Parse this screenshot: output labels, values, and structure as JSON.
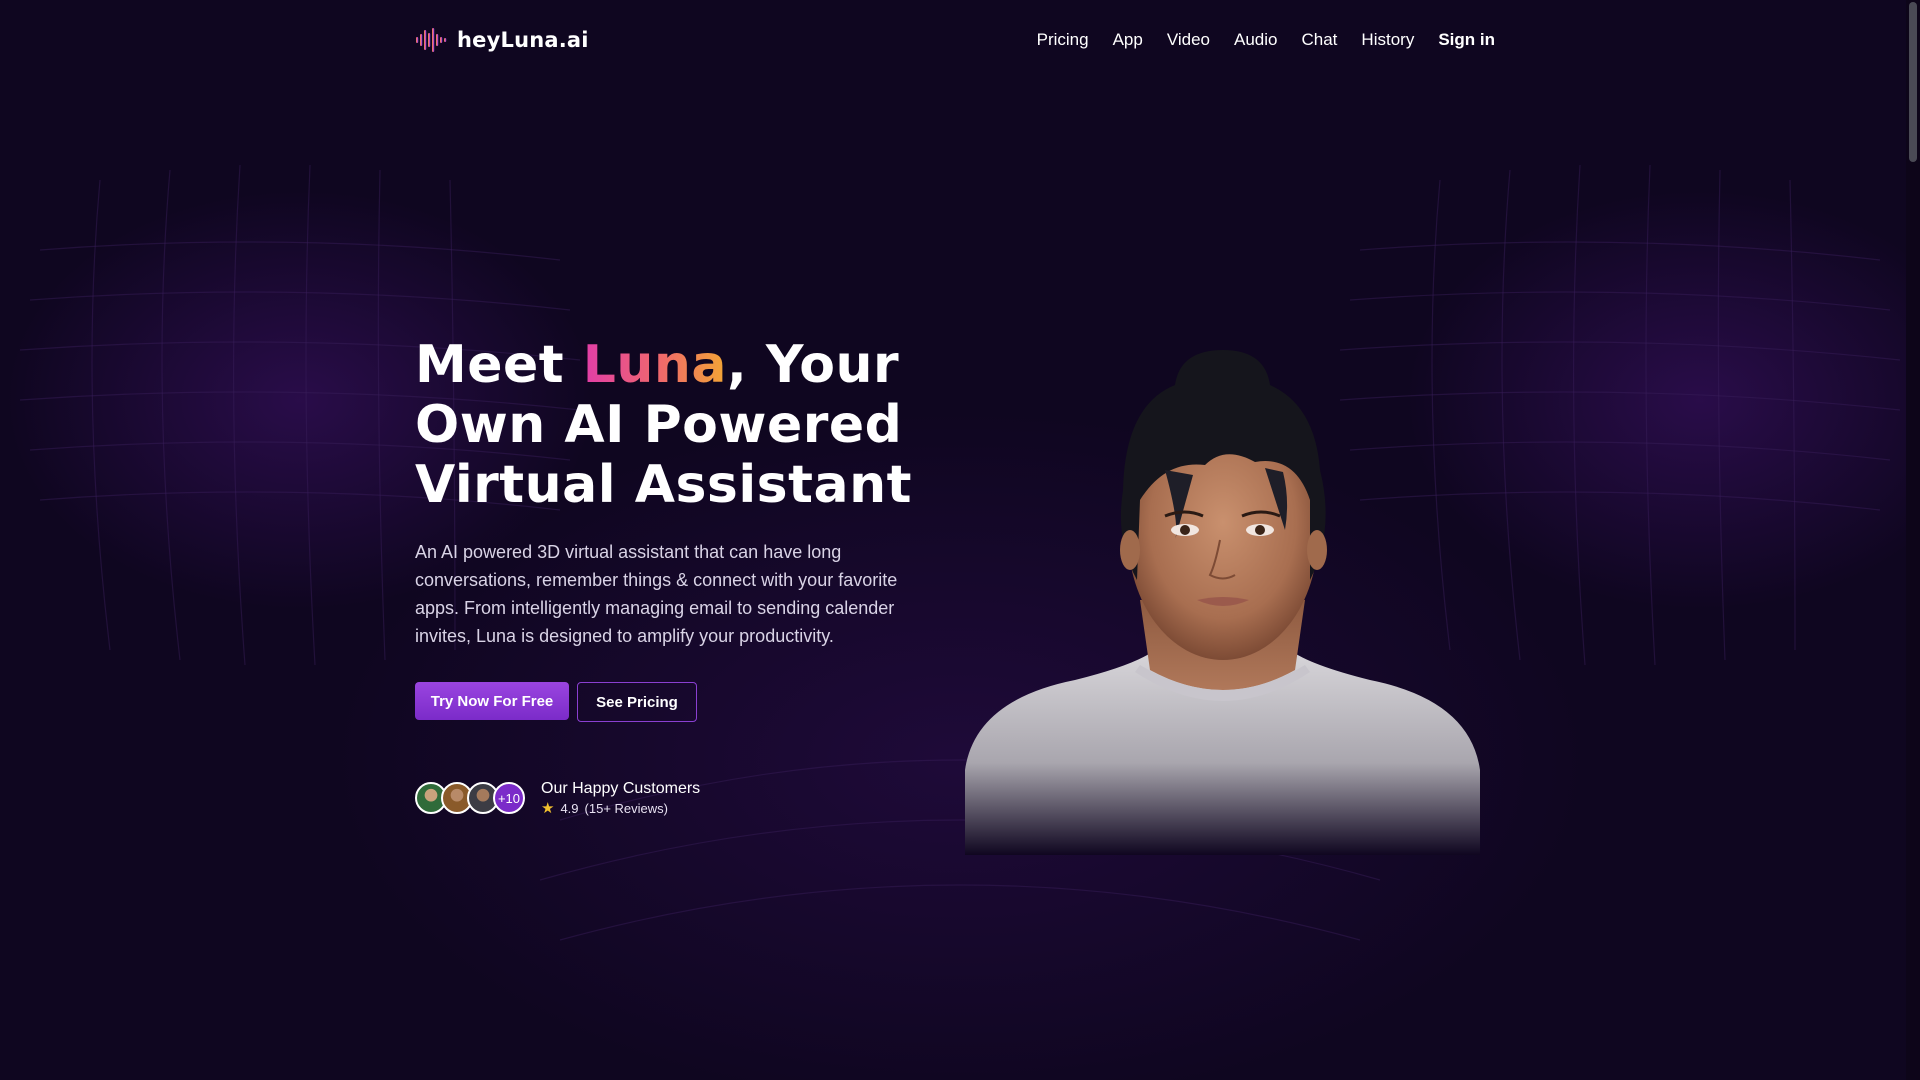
{
  "brand": {
    "name": "heyLuna.ai",
    "logo_icon": "audio-waveform-icon"
  },
  "nav": {
    "items": [
      "Pricing",
      "App",
      "Video",
      "Audio",
      "Chat",
      "History"
    ],
    "signin": "Sign in"
  },
  "hero": {
    "title_prefix": "Meet ",
    "title_highlight": "Luna",
    "title_suffix": ", Your Own AI Powered Virtual Assistant",
    "description": "An AI powered 3D virtual assistant that can have long conversations, remember things & connect with your favorite apps. From intelligently managing email to sending calender invites, Luna is designed to amplify your productivity.",
    "primary_cta": "Try Now For Free",
    "secondary_cta": "See Pricing"
  },
  "social_proof": {
    "more_count": "+10",
    "title": "Our Happy Customers",
    "rating": "4.9",
    "reviews": "(15+ Reviews)",
    "star_icon": "star-icon"
  },
  "colors": {
    "background": "#0f0620",
    "accent": "#8a3fd1",
    "highlight_start": "#e23da8",
    "highlight_end": "#f2a634"
  }
}
